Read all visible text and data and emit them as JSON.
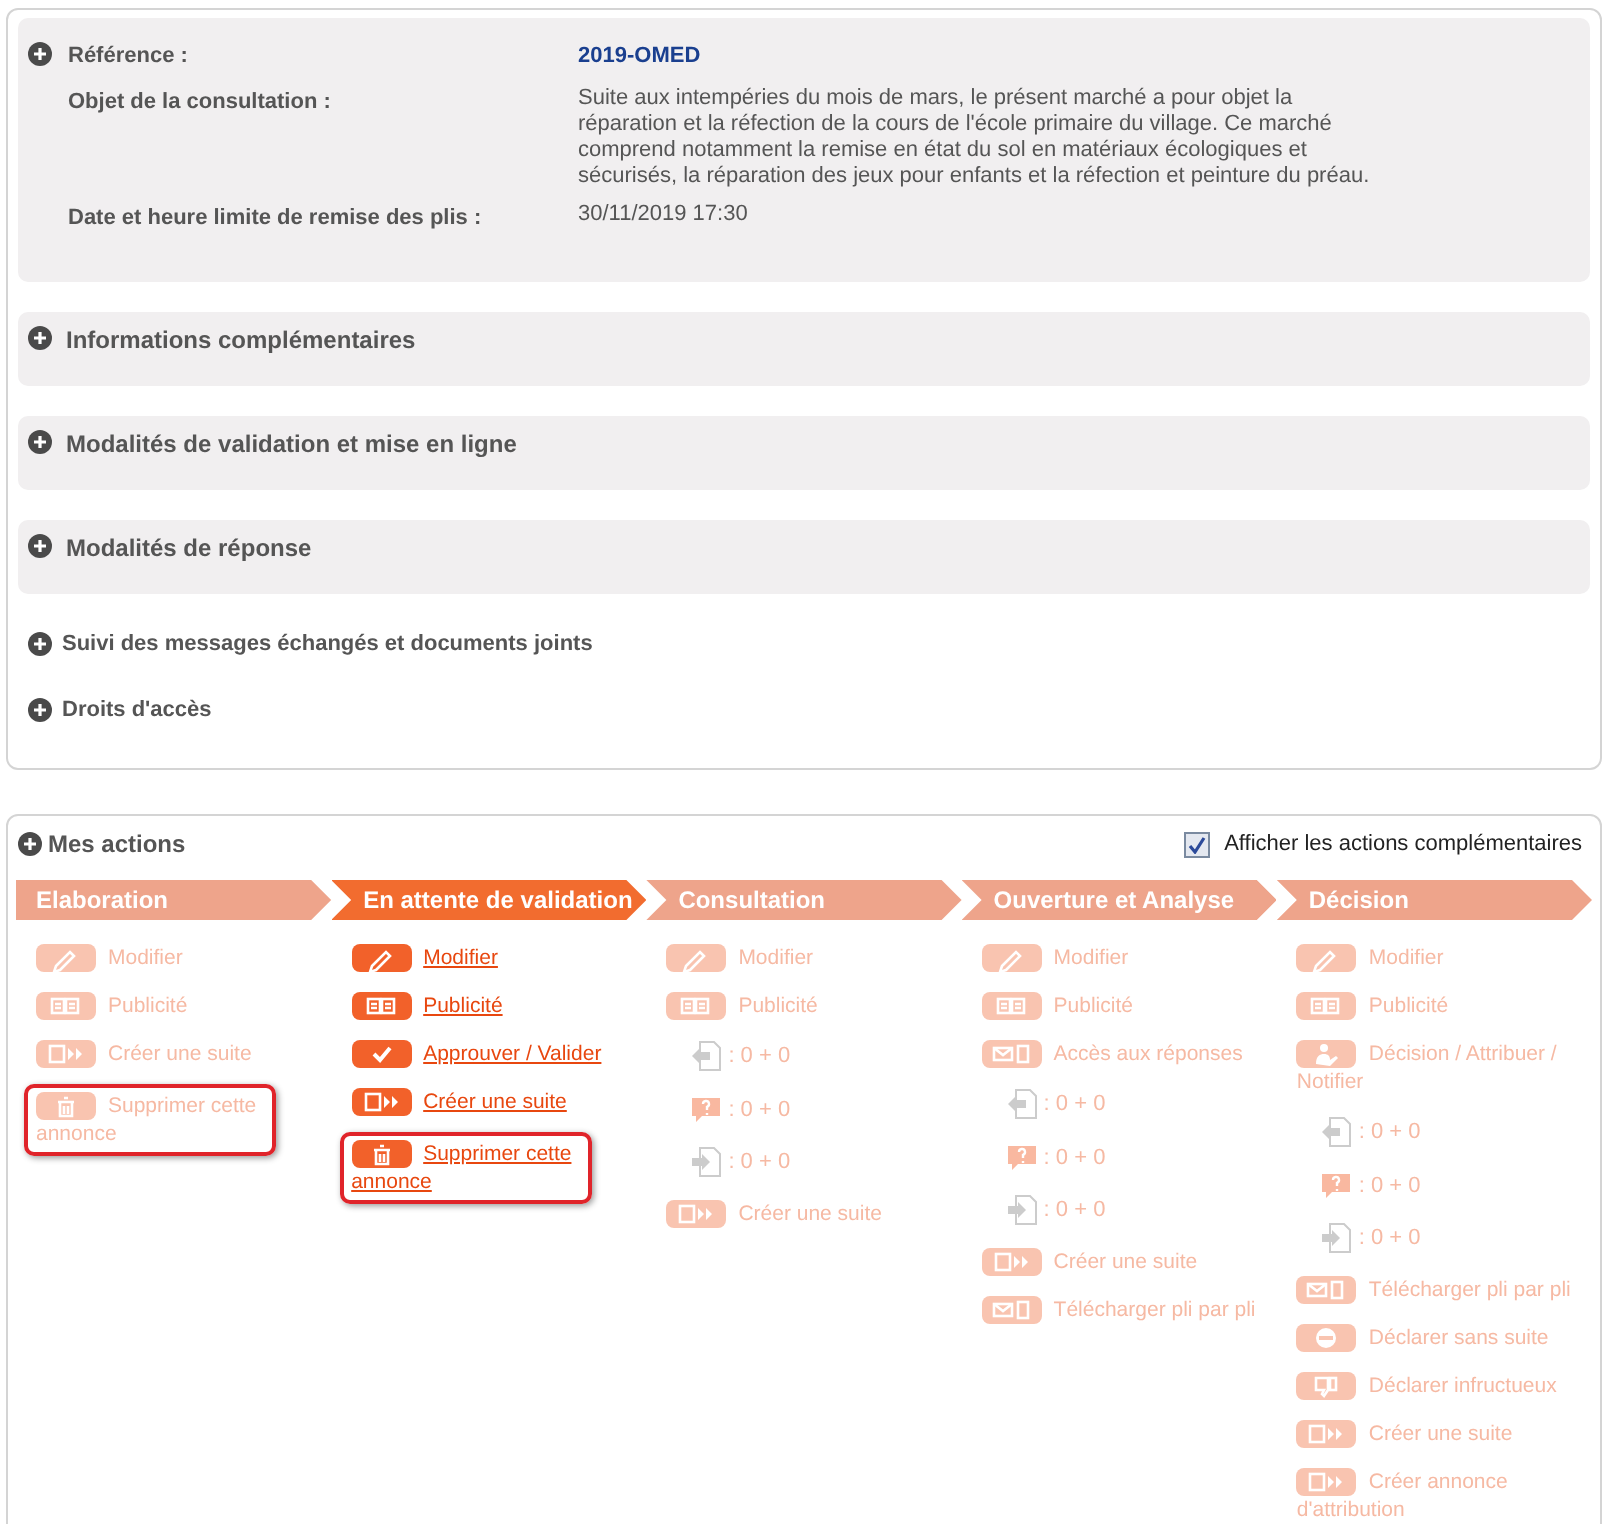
{
  "summary": {
    "rows": [
      {
        "label": "Référence :",
        "value": "2019-OMED",
        "kind": "reference"
      },
      {
        "label": "Objet de la consultation :",
        "value": "Suite aux intempéries du mois de mars, le présent marché a pour objet la réparation et la réfection de la cours de l'école primaire du village. Ce marché comprend notamment la remise en état du sol en matériaux écologiques et sécurisés, la réparation des jeux pour enfants et la réfection et peinture du préau.",
        "kind": "text"
      },
      {
        "label": "Date et heure limite de remise des plis :",
        "value": "30/11/2019 17:30",
        "kind": "text"
      }
    ]
  },
  "sections": [
    {
      "title": "Informations complémentaires",
      "kind": "panel"
    },
    {
      "title": "Modalités de validation et mise en ligne",
      "kind": "panel"
    },
    {
      "title": "Modalités de réponse",
      "kind": "panel"
    },
    {
      "title": "Suivi des messages échangés et documents joints",
      "kind": "link"
    },
    {
      "title": "Droits d'accès",
      "kind": "link"
    }
  ],
  "actions": {
    "title": "Mes actions",
    "show_more": {
      "label": "Afficher les actions complémentaires",
      "checked": true
    },
    "steps": [
      {
        "label": "Elaboration",
        "selected": false,
        "items": [
          {
            "kind": "pencil",
            "label": "Modifier",
            "highlighted": false
          },
          {
            "kind": "book",
            "label": "Publicité",
            "highlighted": false
          },
          {
            "kind": "next",
            "label": "Créer une suite",
            "highlighted": false
          },
          {
            "kind": "trash",
            "label": "Supprimer cette annonce",
            "highlighted": true
          }
        ]
      },
      {
        "label": "En attente de validation",
        "selected": true,
        "items": [
          {
            "kind": "pencil",
            "label": "Modifier",
            "highlighted": false
          },
          {
            "kind": "book",
            "label": "Publicité",
            "highlighted": false
          },
          {
            "kind": "check",
            "label": "Approuver / Valider",
            "highlighted": false
          },
          {
            "kind": "next",
            "label": "Créer une suite",
            "highlighted": false
          },
          {
            "kind": "trash",
            "label": "Supprimer cette annonce",
            "highlighted": true
          }
        ]
      },
      {
        "label": "Consultation",
        "selected": false,
        "items": [
          {
            "kind": "pencil",
            "label": "Modifier",
            "highlighted": false
          },
          {
            "kind": "book",
            "label": "Publicité",
            "highlighted": false
          },
          {
            "kind": "doc-in",
            "label": ": 0 + 0",
            "highlighted": false
          },
          {
            "kind": "question",
            "label": ": 0 + 0",
            "highlighted": false
          },
          {
            "kind": "doc-out",
            "label": ": 0 + 0",
            "highlighted": false
          },
          {
            "kind": "next",
            "label": "Créer une suite",
            "highlighted": false
          }
        ]
      },
      {
        "label": "Ouverture et Analyse",
        "selected": false,
        "items": [
          {
            "kind": "pencil",
            "label": "Modifier",
            "highlighted": false
          },
          {
            "kind": "book",
            "label": "Publicité",
            "highlighted": false
          },
          {
            "kind": "envelope",
            "label": "Accès aux réponses",
            "highlighted": false
          },
          {
            "kind": "doc-in",
            "label": ": 0 + 0",
            "highlighted": false
          },
          {
            "kind": "question",
            "label": ": 0 + 0",
            "highlighted": false
          },
          {
            "kind": "doc-out",
            "label": ": 0 + 0",
            "highlighted": false
          },
          {
            "kind": "next",
            "label": "Créer une suite",
            "highlighted": false
          },
          {
            "kind": "envelope",
            "label": "Télécharger pli par pli",
            "highlighted": false
          }
        ]
      },
      {
        "label": "Décision",
        "selected": false,
        "items": [
          {
            "kind": "pencil",
            "label": "Modifier",
            "highlighted": false
          },
          {
            "kind": "book",
            "label": "Publicité",
            "highlighted": false
          },
          {
            "kind": "person",
            "label": "Décision / Attribuer / Notifier",
            "highlighted": false
          },
          {
            "kind": "doc-in",
            "label": ": 0 + 0",
            "highlighted": false
          },
          {
            "kind": "question",
            "label": ": 0 + 0",
            "highlighted": false
          },
          {
            "kind": "doc-out",
            "label": ": 0 + 0",
            "highlighted": false
          },
          {
            "kind": "envelope",
            "label": "Télécharger pli par pli",
            "highlighted": false
          },
          {
            "kind": "minus",
            "label": "Déclarer sans suite",
            "highlighted": false
          },
          {
            "kind": "thumbdown",
            "label": "Déclarer infructueux",
            "highlighted": false
          },
          {
            "kind": "next",
            "label": "Créer une suite",
            "highlighted": false
          },
          {
            "kind": "next",
            "label": "Créer annonce d'attribution",
            "highlighted": false
          }
        ]
      }
    ]
  }
}
